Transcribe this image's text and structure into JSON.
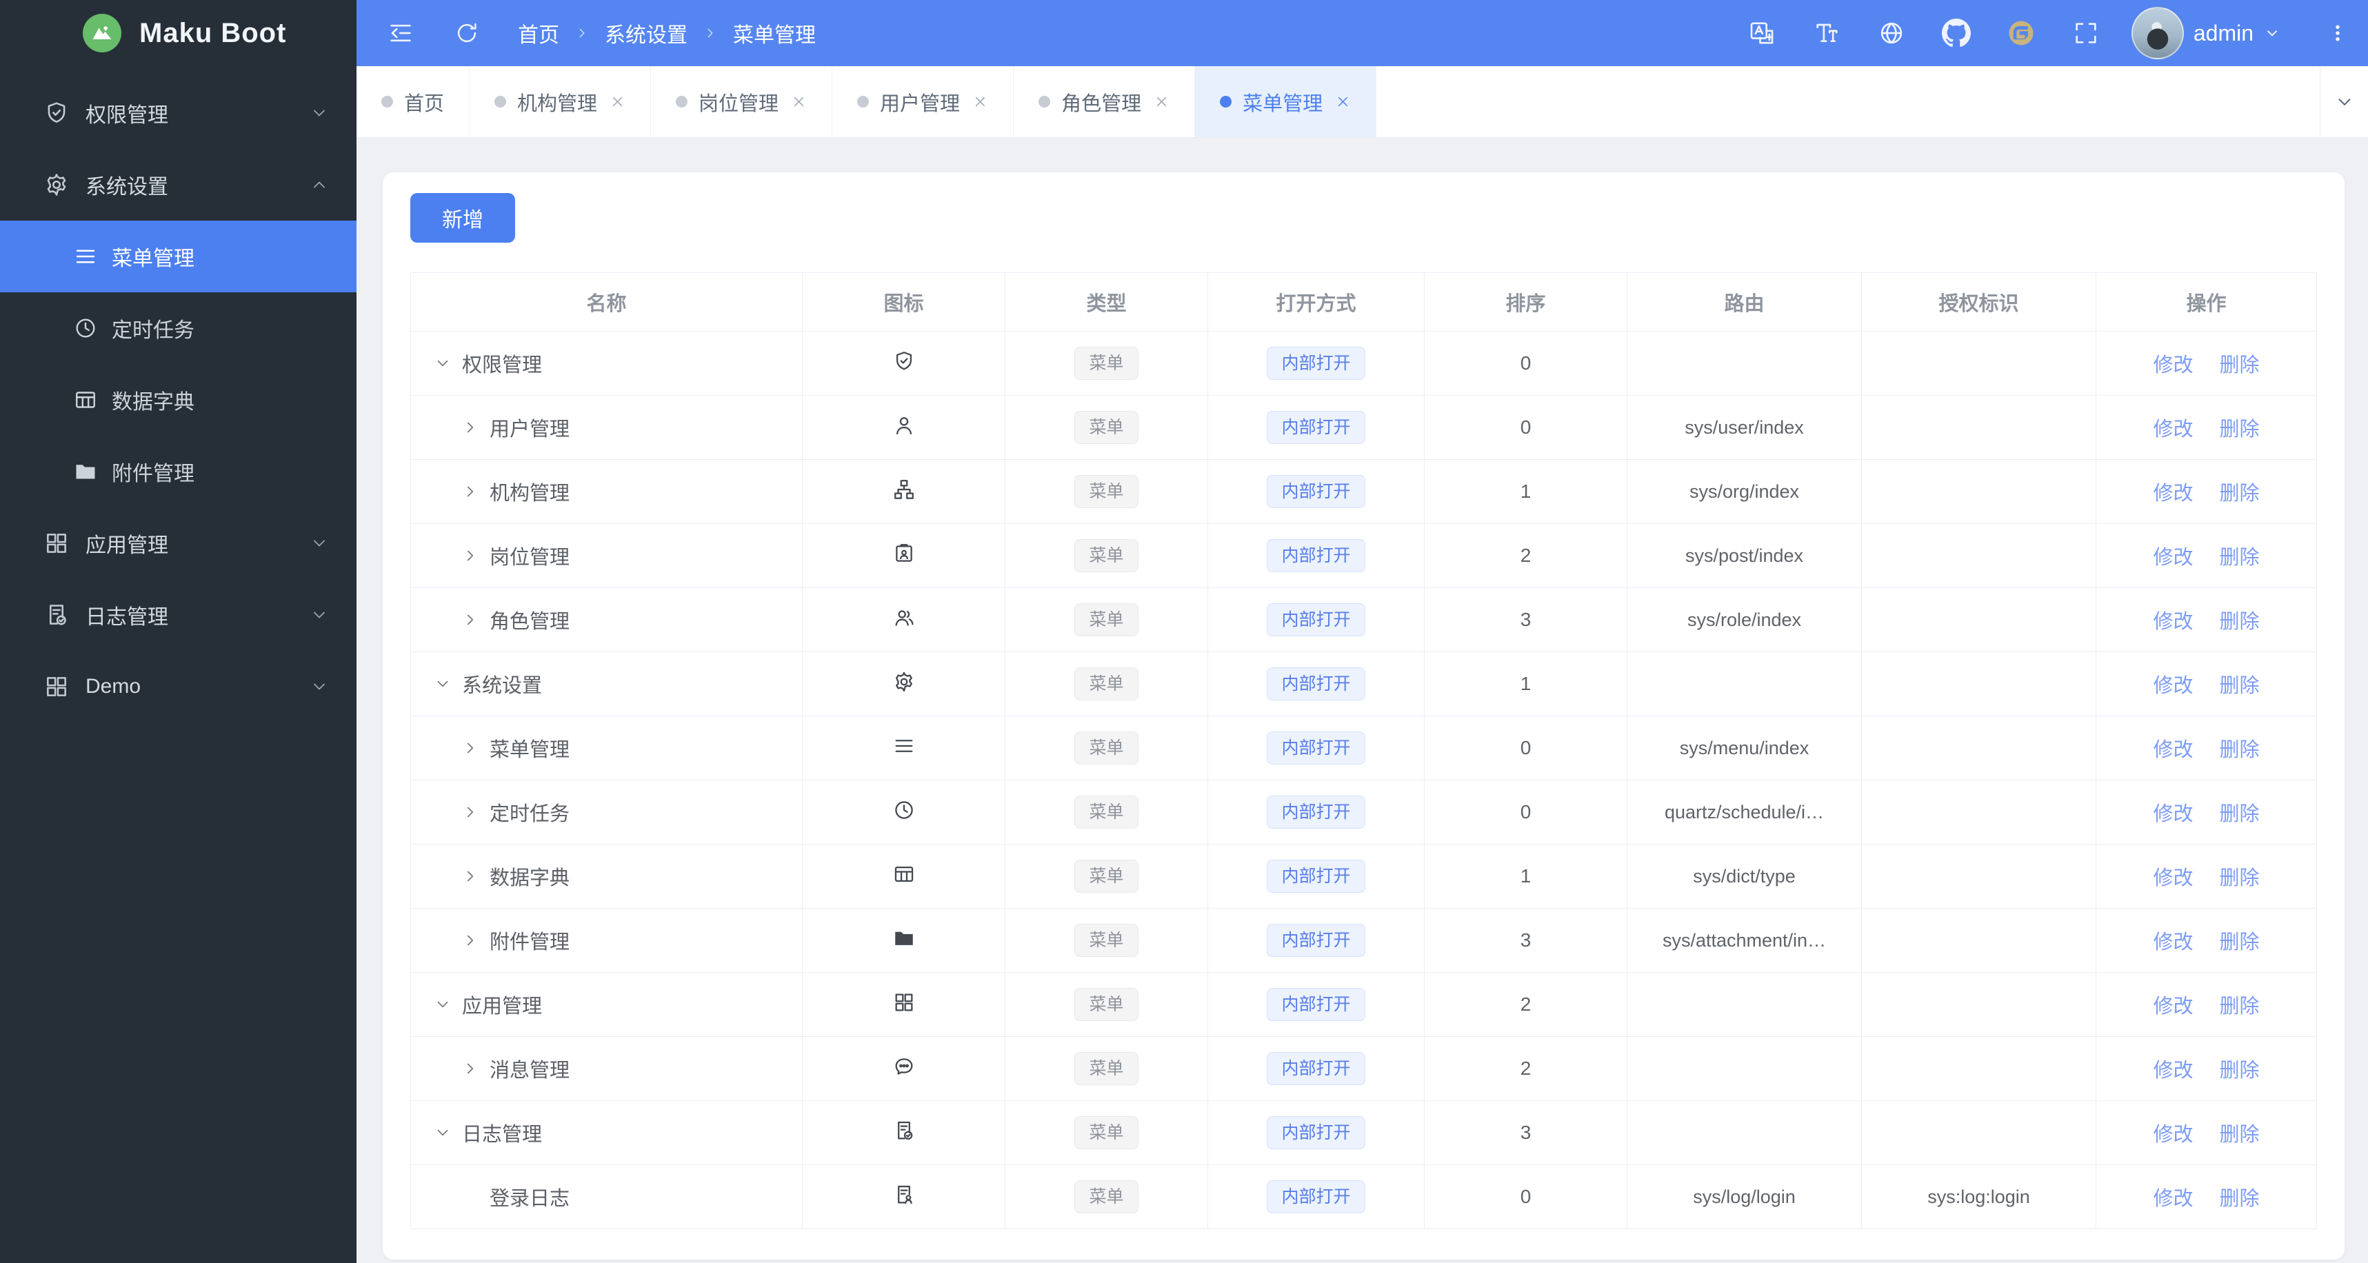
{
  "app": {
    "title": "Maku Boot"
  },
  "colors": {
    "accent": "#4c80f0",
    "header_bg": "#5585f0",
    "sidebar_bg": "#262f38",
    "active_tab_bg": "#e7f0fc"
  },
  "sidebar": {
    "logo_title": "Maku Boot",
    "logo_icon": "mountain-icon",
    "items": [
      {
        "label": "权限管理",
        "icon": "shield-check-icon",
        "chevron": "down",
        "children": []
      },
      {
        "label": "系统设置",
        "icon": "gear-icon",
        "chevron": "up",
        "children": [
          {
            "label": "菜单管理",
            "icon": "menu-icon",
            "active": true
          },
          {
            "label": "定时任务",
            "icon": "clock-icon",
            "active": false
          },
          {
            "label": "数据字典",
            "icon": "dict-icon",
            "active": false
          },
          {
            "label": "附件管理",
            "icon": "folder-icon",
            "active": false
          }
        ]
      },
      {
        "label": "应用管理",
        "icon": "apps-icon",
        "chevron": "down",
        "children": []
      },
      {
        "label": "日志管理",
        "icon": "log-check-icon",
        "chevron": "down",
        "children": []
      },
      {
        "label": "Demo",
        "icon": "apps-icon",
        "chevron": "down",
        "children": []
      }
    ]
  },
  "header": {
    "left_icons": [
      "collapse-icon",
      "refresh-icon"
    ],
    "breadcrumb": [
      "首页",
      "系统设置",
      "菜单管理"
    ],
    "right_icons": [
      "translate-icon",
      "font-size-icon",
      "globe-icon",
      "github-icon",
      "gitee-icon",
      "fullscreen-icon"
    ],
    "user": {
      "name": "admin"
    }
  },
  "tabs": [
    {
      "label": "首页",
      "closable": false,
      "active": false
    },
    {
      "label": "机构管理",
      "closable": true,
      "active": false
    },
    {
      "label": "岗位管理",
      "closable": true,
      "active": false
    },
    {
      "label": "用户管理",
      "closable": true,
      "active": false
    },
    {
      "label": "角色管理",
      "closable": true,
      "active": false
    },
    {
      "label": "菜单管理",
      "closable": true,
      "active": true
    }
  ],
  "toolbar": {
    "add_label": "新增"
  },
  "table": {
    "columns": [
      "名称",
      "图标",
      "类型",
      "打开方式",
      "排序",
      "路由",
      "授权标识",
      "操作"
    ],
    "type_tag": "菜单",
    "open_tag": "内部打开",
    "actions": [
      "修改",
      "删除"
    ],
    "rows": [
      {
        "name": "权限管理",
        "arrow": "down",
        "level": 0,
        "icon": "shield-check-icon",
        "sort": "0",
        "route": "",
        "perm": ""
      },
      {
        "name": "用户管理",
        "arrow": "right",
        "level": 1,
        "icon": "user-icon",
        "sort": "0",
        "route": "sys/user/index",
        "perm": ""
      },
      {
        "name": "机构管理",
        "arrow": "right",
        "level": 1,
        "icon": "org-icon",
        "sort": "1",
        "route": "sys/org/index",
        "perm": ""
      },
      {
        "name": "岗位管理",
        "arrow": "right",
        "level": 1,
        "icon": "post-icon",
        "sort": "2",
        "route": "sys/post/index",
        "perm": ""
      },
      {
        "name": "角色管理",
        "arrow": "right",
        "level": 1,
        "icon": "role-icon",
        "sort": "3",
        "route": "sys/role/index",
        "perm": ""
      },
      {
        "name": "系统设置",
        "arrow": "down",
        "level": 0,
        "icon": "gear-icon",
        "sort": "1",
        "route": "",
        "perm": ""
      },
      {
        "name": "菜单管理",
        "arrow": "right",
        "level": 1,
        "icon": "menu-icon",
        "sort": "0",
        "route": "sys/menu/index",
        "perm": ""
      },
      {
        "name": "定时任务",
        "arrow": "right",
        "level": 1,
        "icon": "clock-icon",
        "sort": "0",
        "route": "quartz/schedule/i…",
        "perm": ""
      },
      {
        "name": "数据字典",
        "arrow": "right",
        "level": 1,
        "icon": "dict-icon",
        "sort": "1",
        "route": "sys/dict/type",
        "perm": ""
      },
      {
        "name": "附件管理",
        "arrow": "right",
        "level": 1,
        "icon": "folder-icon",
        "sort": "3",
        "route": "sys/attachment/in…",
        "perm": ""
      },
      {
        "name": "应用管理",
        "arrow": "down",
        "level": 0,
        "icon": "apps-icon",
        "sort": "2",
        "route": "",
        "perm": ""
      },
      {
        "name": "消息管理",
        "arrow": "right",
        "level": 1,
        "icon": "message-icon",
        "sort": "2",
        "route": "",
        "perm": ""
      },
      {
        "name": "日志管理",
        "arrow": "down",
        "level": 0,
        "icon": "log-check-icon",
        "sort": "3",
        "route": "",
        "perm": ""
      },
      {
        "name": "登录日志",
        "arrow": null,
        "level": 1,
        "icon": "login-log-icon",
        "sort": "0",
        "route": "sys/log/login",
        "perm": "sys:log:login"
      }
    ]
  }
}
